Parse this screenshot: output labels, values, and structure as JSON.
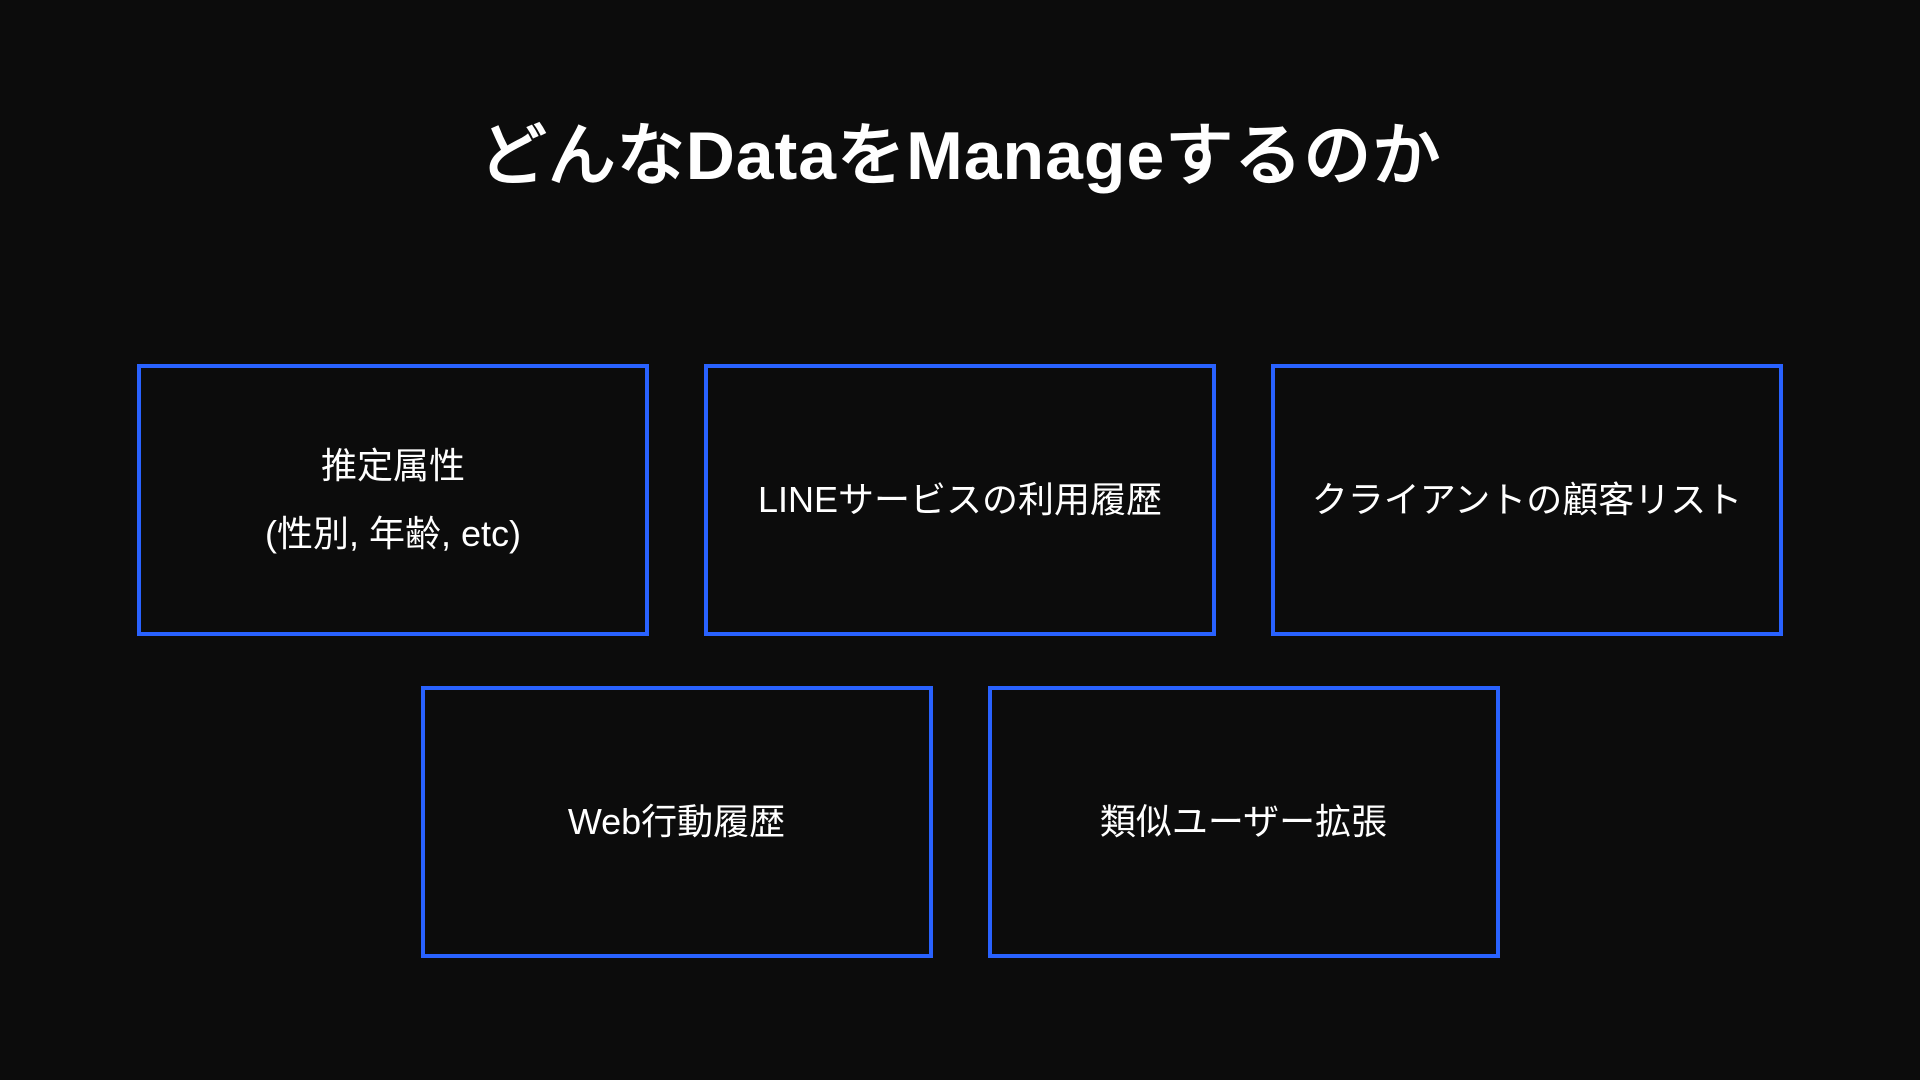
{
  "title": "どんなDataをManageするのか",
  "boxes": {
    "row1": [
      {
        "line1": "推定属性",
        "line2": "(性別, 年齢, etc)"
      },
      {
        "line1": "LINEサービスの利用履歴",
        "line2": ""
      },
      {
        "line1": "クライアントの顧客リスト",
        "line2": ""
      }
    ],
    "row2": [
      {
        "line1": "Web行動履歴",
        "line2": ""
      },
      {
        "line1": "類似ユーザー拡張",
        "line2": ""
      }
    ]
  }
}
